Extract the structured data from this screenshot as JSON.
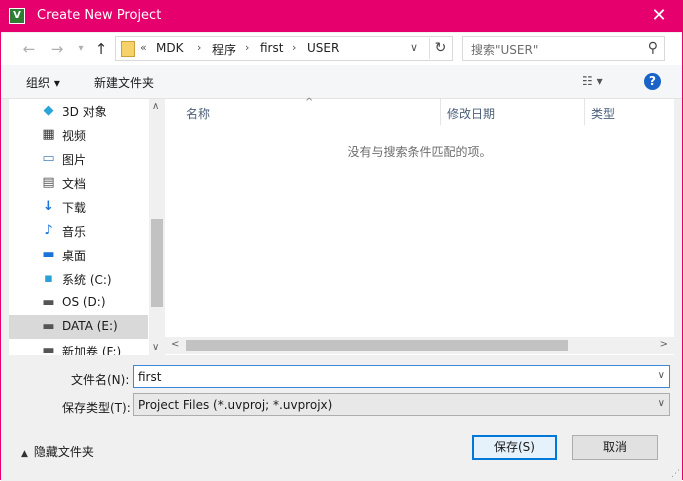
{
  "window": {
    "title": "Create New Project",
    "app_icon_glyph": "V",
    "accent_color": "#e6006e"
  },
  "nav": {
    "back_icon": "arrow-left-icon",
    "forward_icon": "arrow-right-icon",
    "up_icon": "arrow-up-icon",
    "overflow": "«",
    "breadcrumbs": [
      "MDK",
      "程序",
      "first",
      "USER"
    ],
    "search_placeholder": "搜索\"USER\""
  },
  "toolbar": {
    "organize": "组织 ▾",
    "new_folder": "新建文件夹",
    "help": "?"
  },
  "sidebar": {
    "items": [
      {
        "label": "3D 对象",
        "icon": "cube-icon"
      },
      {
        "label": "视频",
        "icon": "video-icon"
      },
      {
        "label": "图片",
        "icon": "picture-icon"
      },
      {
        "label": "文档",
        "icon": "document-icon"
      },
      {
        "label": "下载",
        "icon": "download-icon"
      },
      {
        "label": "音乐",
        "icon": "music-icon"
      },
      {
        "label": "桌面",
        "icon": "desktop-icon"
      },
      {
        "label": "系统 (C:)",
        "icon": "system-drive-icon"
      },
      {
        "label": "OS (D:)",
        "icon": "drive-icon"
      },
      {
        "label": "DATA (E:)",
        "icon": "drive-icon",
        "selected": true
      },
      {
        "label": "新加卷 (F:)",
        "icon": "drive-icon"
      }
    ]
  },
  "file_list": {
    "columns": [
      "名称",
      "修改日期",
      "类型"
    ],
    "empty_message": "没有与搜索条件匹配的项。"
  },
  "form": {
    "filename_label": "文件名(N):",
    "filename_value": "first",
    "filetype_label": "保存类型(T):",
    "filetype_value": "Project Files (*.uvproj; *.uvprojx)"
  },
  "footer": {
    "hide_folders": "隐藏文件夹",
    "save_button": "保存(S)",
    "cancel_button": "取消"
  }
}
